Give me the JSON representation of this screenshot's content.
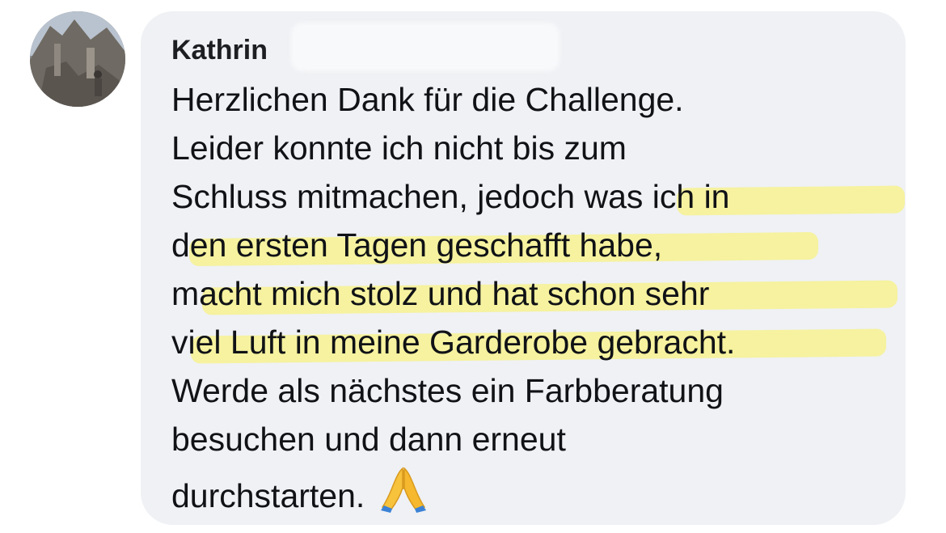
{
  "comment": {
    "author": "Kathrin",
    "lines": [
      "Herzlichen Dank für die Challenge.",
      "Leider konnte ich nicht bis zum",
      "Schluss mitmachen, jedoch was ich in",
      "den ersten Tagen geschafft habe,",
      "macht mich stolz und hat schon sehr",
      "viel Luft in meine Garderobe gebracht.",
      "Werde als nächstes ein Farbberatung",
      "besuchen und dann erneut",
      "durchstarten."
    ],
    "emoji": "folded-hands-emoji"
  },
  "colors": {
    "bubble": "#eff1f4",
    "highlight": "#f6f19a",
    "text": "#101216"
  }
}
